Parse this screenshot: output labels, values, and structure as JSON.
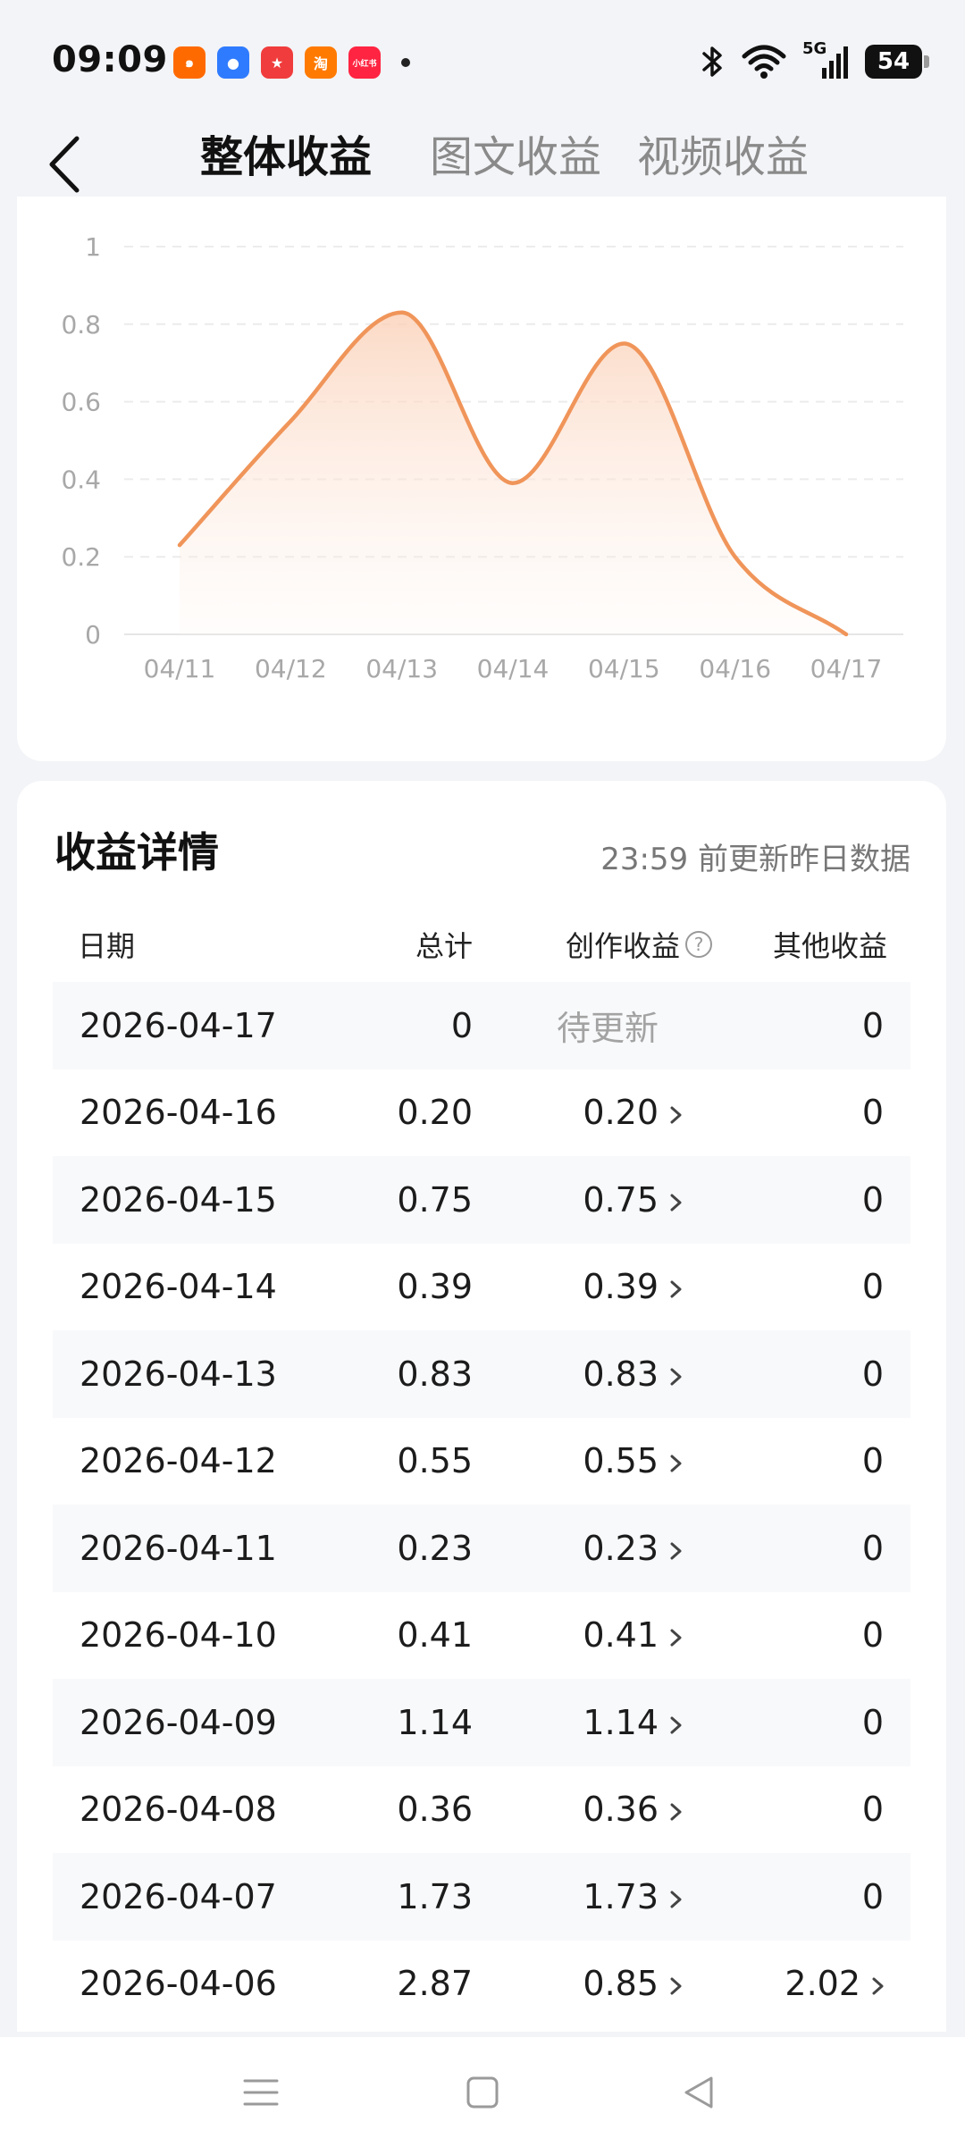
{
  "status": {
    "time": "09:09",
    "network": "5G",
    "battery": "54",
    "apps": [
      {
        "name": "kuaishou-app-icon",
        "color": "#ff6a00",
        "glyph": "๑"
      },
      {
        "name": "browser-app-icon",
        "color": "#2f7bff",
        "glyph": "●"
      },
      {
        "name": "game-app-icon",
        "color": "#f03c3c",
        "glyph": "★"
      },
      {
        "name": "taobao-app-icon",
        "color": "#ff7a00",
        "glyph": "淘"
      },
      {
        "name": "xiaohongshu-app-icon",
        "color": "#ff2442",
        "glyph": "小红书"
      }
    ]
  },
  "header": {
    "tabs": [
      "整体收益",
      "图文收益",
      "视频收益"
    ],
    "active_tab": 0
  },
  "chart_data": {
    "type": "line",
    "x": [
      "04/11",
      "04/12",
      "04/13",
      "04/14",
      "04/15",
      "04/16",
      "04/17"
    ],
    "series": [
      {
        "values": [
          0.23,
          0.55,
          0.83,
          0.39,
          0.75,
          0.2,
          0
        ]
      }
    ],
    "yticks": [
      "0",
      "0.2",
      "0.4",
      "0.6",
      "0.8",
      "1"
    ],
    "ylim": [
      0,
      1
    ],
    "grid": true,
    "line_color": "#f0955a"
  },
  "details": {
    "title": "收益详情",
    "update_note": "23:59 前更新昨日数据",
    "columns": {
      "date": "日期",
      "total": "总计",
      "creation": "创作收益",
      "other": "其他收益"
    },
    "rows": [
      {
        "date": "2026-04-17",
        "total": "0",
        "creation": "待更新",
        "other": "0",
        "pending": true
      },
      {
        "date": "2026-04-16",
        "total": "0.20",
        "creation": "0.20",
        "other": "0"
      },
      {
        "date": "2026-04-15",
        "total": "0.75",
        "creation": "0.75",
        "other": "0"
      },
      {
        "date": "2026-04-14",
        "total": "0.39",
        "creation": "0.39",
        "other": "0"
      },
      {
        "date": "2026-04-13",
        "total": "0.83",
        "creation": "0.83",
        "other": "0"
      },
      {
        "date": "2026-04-12",
        "total": "0.55",
        "creation": "0.55",
        "other": "0"
      },
      {
        "date": "2026-04-11",
        "total": "0.23",
        "creation": "0.23",
        "other": "0"
      },
      {
        "date": "2026-04-10",
        "total": "0.41",
        "creation": "0.41",
        "other": "0"
      },
      {
        "date": "2026-04-09",
        "total": "1.14",
        "creation": "1.14",
        "other": "0"
      },
      {
        "date": "2026-04-08",
        "total": "0.36",
        "creation": "0.36",
        "other": "0"
      },
      {
        "date": "2026-04-07",
        "total": "1.73",
        "creation": "1.73",
        "other": "0"
      },
      {
        "date": "2026-04-06",
        "total": "2.87",
        "creation": "0.85",
        "other": "2.02",
        "other_link": true
      }
    ]
  }
}
